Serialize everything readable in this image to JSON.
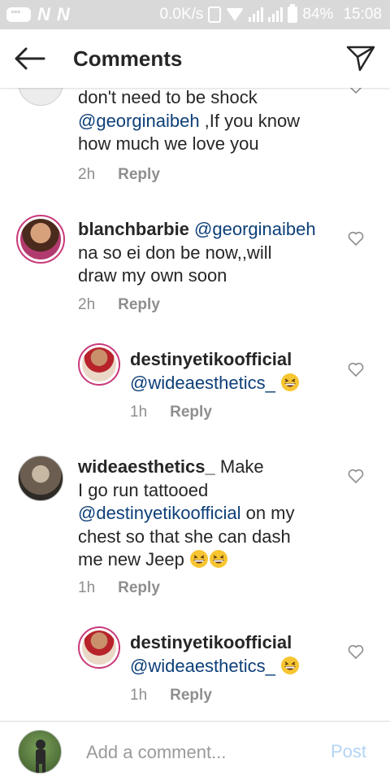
{
  "status_bar": {
    "net_letters": [
      "N",
      "N"
    ],
    "speed": "0.0K/s",
    "battery": "84%",
    "time": "15:08"
  },
  "header": {
    "title": "Comments"
  },
  "comments": [
    {
      "text_lines": [
        "don't need to be shock"
      ],
      "mention": "@georginaibeh",
      "mention_suffix": " ,If you know",
      "last_line": "how much we love you",
      "time": "2h",
      "reply": "Reply"
    },
    {
      "username": "blanchbarbie",
      "mention": "@georginaibeh",
      "line2": "na so ei don be now,,will",
      "line3": "draw my own soon",
      "time": "2h",
      "reply": "Reply"
    },
    {
      "username": "destinyetikoofficial",
      "mention": "@wideaesthetics_",
      "emoji": "grinning-squinting-face",
      "time": "1h",
      "reply": "Reply"
    },
    {
      "username": "wideaesthetics_",
      "line1_suffix": "Make",
      "line2": "I go run tattooed",
      "mention": "@destinyetikoofficial",
      "mention_suffix": " on my",
      "line4": "chest so that she can dash",
      "line5": "me new Jeep",
      "time": "1h",
      "reply": "Reply"
    },
    {
      "username": "destinyetikoofficial",
      "mention": "@wideaesthetics_",
      "emoji": "grinning-squinting-face",
      "time": "1h",
      "reply": "Reply"
    }
  ],
  "composer": {
    "placeholder": "Add a comment...",
    "post_label": "Post"
  },
  "colors": {
    "mention": "#0d3f78",
    "meta": "#8e8e8e",
    "post_disabled": "#b3d4f6",
    "status_bar": "#d9d9d9"
  }
}
